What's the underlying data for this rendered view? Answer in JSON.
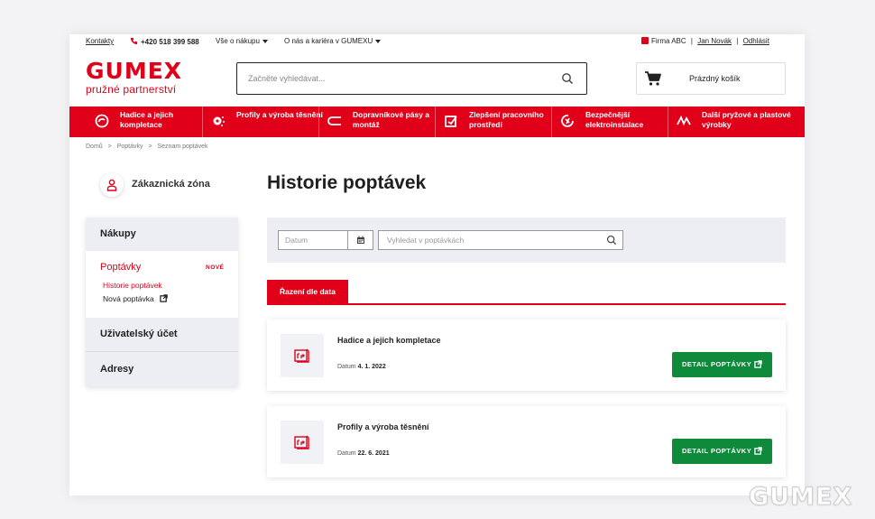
{
  "topbar": {
    "contacts": "Kontakty",
    "phone": "+420 518 399 588",
    "shopping_menu": "Vše o nákupu",
    "about_menu": "O nás a kariéra v GUMEXU",
    "company": "Firma ABC",
    "user": "Jan Novák",
    "logout": "Odhlásit",
    "separator": "|"
  },
  "header": {
    "logo_brand": "GUMEX",
    "logo_tagline": "pružné partnerství",
    "search_placeholder": "Začněte vyhledávat...",
    "cart_label": "Prázdný košík"
  },
  "nav": {
    "items": [
      {
        "label": "Hadice a jejich kompletace",
        "icon": "hose-icon"
      },
      {
        "label": "Profily a výroba těsnění",
        "icon": "gear-seal-icon"
      },
      {
        "label": "Dopravníkové pásy a montáž",
        "icon": "conveyor-icon"
      },
      {
        "label": "Zlepšení pracovního prostředí",
        "icon": "workspace-icon"
      },
      {
        "label": "Bezpečnější elektroinstalace",
        "icon": "electric-icon"
      },
      {
        "label": "Další pryžové a plastové výrobky",
        "icon": "wave-icon"
      }
    ]
  },
  "breadcrumb": {
    "items": [
      "Domů",
      "Poptávky",
      "Seznam poptávek"
    ],
    "separator": ">"
  },
  "zone": {
    "label": "Zákaznická zóna"
  },
  "page_title": "Historie poptávek",
  "sidebar": {
    "purchases": "Nákupy",
    "inquiries": "Poptávky",
    "new_badge": "NOVÉ",
    "history": "Historie poptávek",
    "new_inquiry": "Nová poptávka",
    "account": "Uživatelský účet",
    "addresses": "Adresy"
  },
  "filter": {
    "date_placeholder": "Datum",
    "search_placeholder": "Vyhledat v poptávkách"
  },
  "tabs": {
    "sort_by_date": "Řazení dle data"
  },
  "inquiries": [
    {
      "name": "Hadice a jejich kompletace",
      "date_label": "Datum",
      "date": "4. 1. 2022",
      "button": "DETAIL POPTÁVKY"
    },
    {
      "name": "Profily a výroba těsnění",
      "date_label": "Datum",
      "date": "22. 6. 2021",
      "button": "DETAIL POPTÁVKY"
    }
  ],
  "watermark": "GUMEX",
  "colors": {
    "brand_red": "#e1001a",
    "button_green": "#0f8a3b",
    "panel_gray": "#eceef4"
  }
}
